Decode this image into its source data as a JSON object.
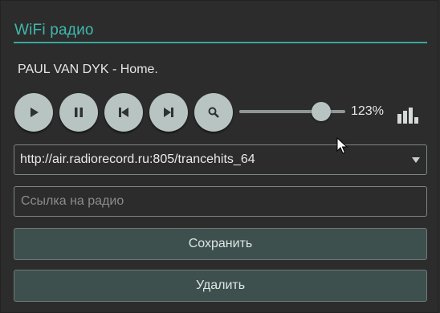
{
  "header": {
    "title": "WiFi радио",
    "accent_color": "#3fb8ac"
  },
  "now_playing": {
    "track": "PAUL VAN DYK - Home."
  },
  "controls": {
    "buttons": [
      {
        "name": "play",
        "icon": "play-icon"
      },
      {
        "name": "pause",
        "icon": "pause-icon"
      },
      {
        "name": "previous",
        "icon": "skip-previous-icon"
      },
      {
        "name": "next",
        "icon": "skip-next-icon"
      },
      {
        "name": "search",
        "icon": "search-icon"
      }
    ],
    "volume": {
      "value_fraction": 0.77,
      "label": "123%",
      "level_icon": "signal-bars-icon"
    }
  },
  "station_select": {
    "selected": "http://air.radiorecord.ru:805/trancehits_64"
  },
  "url_input": {
    "value": "",
    "placeholder": "Ссылка на радио"
  },
  "actions": {
    "save_label": "Сохранить",
    "delete_label": "Удалить"
  }
}
